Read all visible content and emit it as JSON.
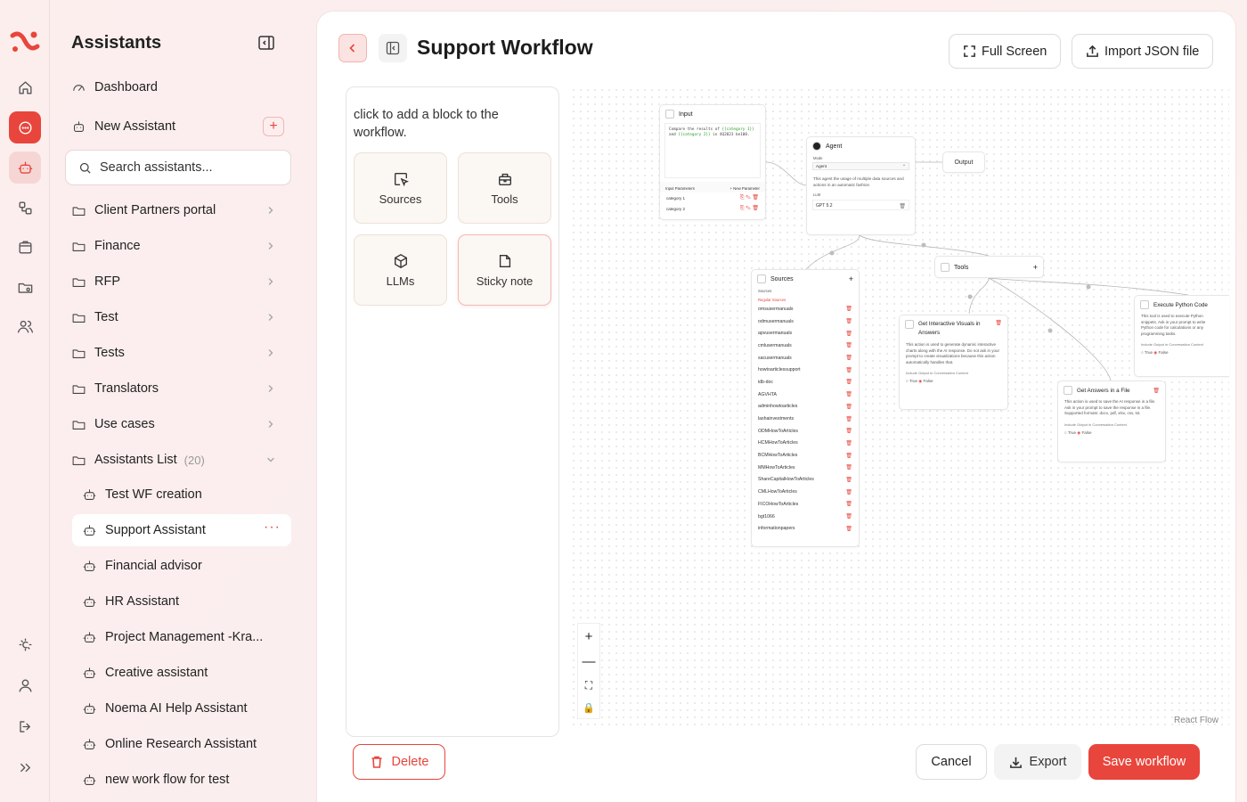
{
  "sidebar": {
    "title": "Assistants",
    "dashboard": "Dashboard",
    "new_assistant": "New Assistant",
    "search_placeholder": "Search assistants...",
    "folders": [
      "Client Partners portal",
      "Finance",
      "RFP",
      "Test",
      "Tests",
      "Translators",
      "Use cases"
    ],
    "list_label": "Assistants List",
    "list_count": "(20)",
    "assistants": [
      "Test WF creation",
      "Support Assistant",
      "Financial advisor",
      "HR Assistant",
      "Project Management -Kra...",
      "Creative assistant",
      "Noema AI Help Assistant",
      "Online Research Assistant",
      "new work flow for test"
    ]
  },
  "header": {
    "title": "Support Workflow",
    "full_screen": "Full Screen",
    "import_json": "Import JSON file"
  },
  "blocks": {
    "hint": "click to add a block to the workflow.",
    "sources": "Sources",
    "tools": "Tools",
    "llms": "LLMs",
    "sticky": "Sticky note"
  },
  "canvas": {
    "input": {
      "title": "Input",
      "text_a": "Compare the results of ",
      "var1": "{{category 1}}",
      "text_b": " and ",
      "var2": "{{category 2}}",
      "text_c": " in 4Q2023 be100.",
      "params_label": "Input Parameters",
      "new_param": "New Parameter",
      "params": [
        "category 1",
        "category 2"
      ]
    },
    "agent": {
      "title": "Agent",
      "mode_label": "Mode",
      "mode_value": "Agent",
      "desc": "This agent the usage of multiple data sources and actions in an automatic fashion",
      "llm_label": "LLM",
      "llm_value": "GPT 5.2"
    },
    "output": "Output",
    "tools": "Tools",
    "sources": {
      "title": "Sources",
      "label": "Sources",
      "section": "Regular Sources",
      "items": [
        "omsusermanuals",
        "odmusermanuals",
        "apvusermanuals",
        "cmlusermanuals",
        "sacusermanuals",
        "howtoarticlessupport",
        "idb-doc",
        "AGVHTA",
        "adminhowtoarticles",
        "lashainvestments",
        "ODMHowToArticles",
        "HCMHowToArticles",
        "BCMHowToArticles",
        "MMHowToArticles",
        "ShareCapitalHowToArticles",
        "CMLHowToArticles",
        "FICOHowToArticles",
        "bgt1066",
        "informationpapers"
      ]
    },
    "visuals": {
      "title": "Get Interactive Visuals in Answers",
      "desc": "This action is used to generate dynamic interactive charts along with the AI response. Do not ask in your prompt to create visualizations because this action automatically handles that.",
      "ctx": "Include Output in Conversation Context",
      "true": "True",
      "false": "False"
    },
    "file": {
      "title": "Get Answers in a File",
      "desc": "This action is used to save the AI response in a file. Ask in your prompt to save the response in a file. Supported formats: docx, pdf, xlsx, csv, txt.",
      "ctx": "Include Output in Conversation Context",
      "true": "True",
      "false": "False"
    },
    "python": {
      "title": "Execute Python Code",
      "desc": "This tool is used to execute Python snippets. Ask in your prompt to write Python code for calculations or any programming tasks.",
      "ctx": "Include Output in Conversation Context",
      "true": "True",
      "false": "False"
    },
    "react_flow": "React Flow"
  },
  "footer": {
    "delete": "Delete",
    "cancel": "Cancel",
    "export": "Export",
    "save": "Save workflow"
  },
  "colors": {
    "accent": "#e8453c"
  }
}
